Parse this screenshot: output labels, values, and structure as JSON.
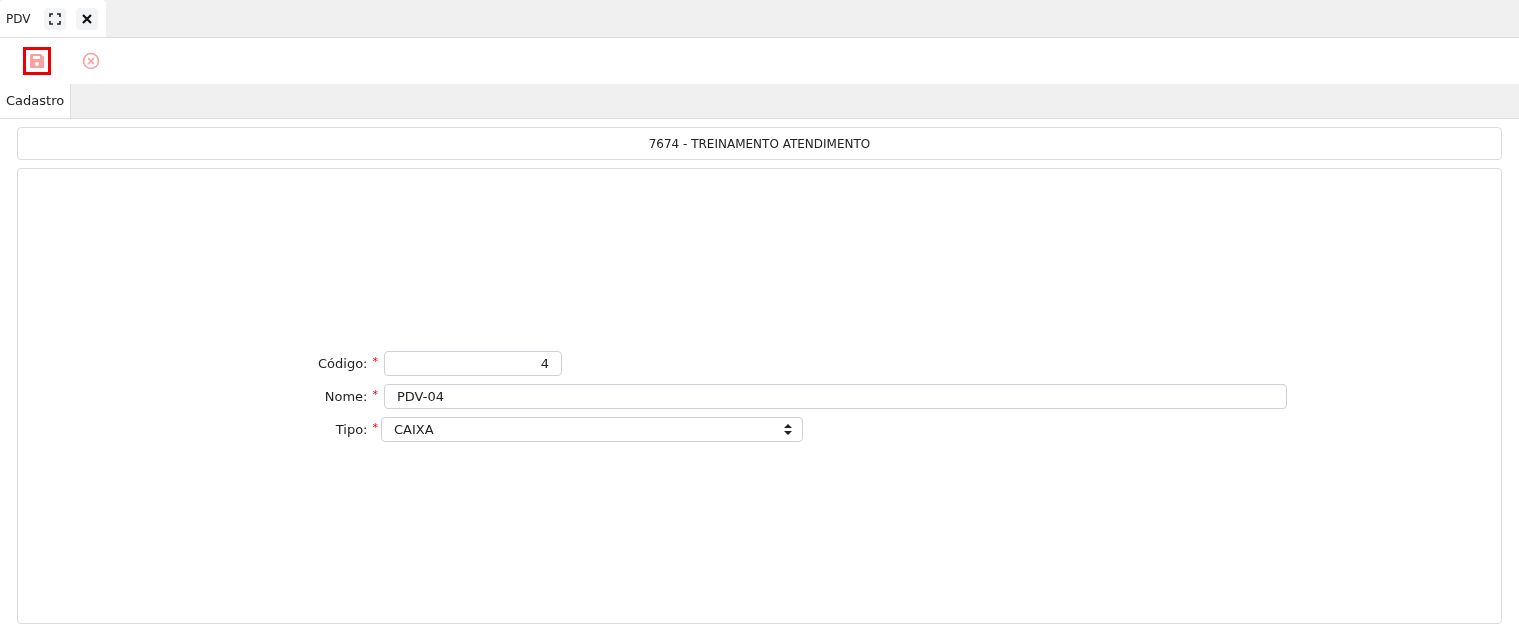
{
  "window_tabs": [
    {
      "label": "PDV",
      "selected": true
    }
  ],
  "toolbar": [
    {
      "kind": "save",
      "focused": true
    },
    {
      "kind": "cancel",
      "focused": false
    }
  ],
  "form_tabs": [
    {
      "label": "Cadastro",
      "selected": true
    }
  ],
  "header": "7674 - TREINAMENTO ATENDIMENTO",
  "fields": [
    {
      "label": "Código:",
      "required_mark": "*",
      "kind": "number",
      "value": "4"
    },
    {
      "label": "Nome:",
      "required_mark": "*",
      "kind": "text",
      "value": "PDV-04"
    },
    {
      "label": "Tipo:",
      "required_mark": "*",
      "kind": "select",
      "value": "CAIXA"
    }
  ]
}
